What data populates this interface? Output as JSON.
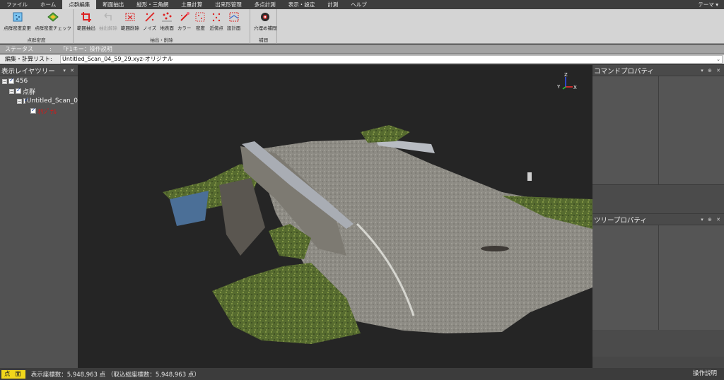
{
  "menu": {
    "items": [
      "ファイル",
      "ホーム",
      "点群編集",
      "断面抽出",
      "縦形・三角網",
      "土量計算",
      "出来形管理",
      "多点計測",
      "表示・設定",
      "計測",
      "ヘルプ"
    ],
    "active_index": 2,
    "theme": "テーマ ▾"
  },
  "ribbon": {
    "groups": [
      {
        "label": "点群密度",
        "buttons": [
          "点群密度変更",
          "点群密度チェック"
        ]
      },
      {
        "label": "抽出・削除",
        "buttons": [
          "範囲抽出",
          "抽出解除",
          "範囲削除",
          "ノイズ",
          "地表面",
          "カラー",
          "密度",
          "近傍点",
          "設計面"
        ]
      },
      {
        "label": "補間",
        "buttons": [
          "穴埋め補間"
        ]
      }
    ]
  },
  "status": {
    "label": "ステータス",
    "colon": ":",
    "value": "「F1キー：操作説明"
  },
  "edit": {
    "label": "編集・計算リスト:",
    "value": "Untitled_Scan_04_59_29.xyz-オリジナル"
  },
  "left_panel": {
    "title": "表示レイヤツリー",
    "controls": "▾ ✕",
    "tree": [
      "456",
      "点群",
      "Untitled_Scan_0",
      "ｵﾘｼﾞﾅﾙ"
    ]
  },
  "right_panel": {
    "command_title": "コマンドプロパティ",
    "tree_title": "ツリープロパティ",
    "controls": "▾ ⊕ ✕"
  },
  "axis": {
    "z": "Z",
    "y": "Y",
    "x": "X"
  },
  "colors": {
    "accent": "#f1d71b",
    "menu_active": "#d7d7d7",
    "viewport_bg": "#252525"
  },
  "bottom": {
    "mode": "点 面",
    "count_text": "表示座標数：5,948,963 点 （取込総座標数：5,948,963 点）",
    "help": "操作説明"
  }
}
